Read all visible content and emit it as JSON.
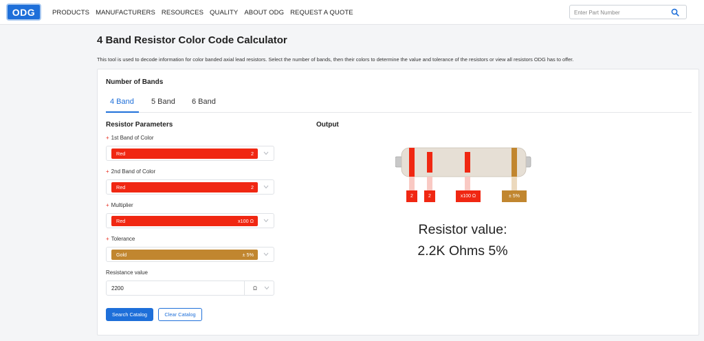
{
  "header": {
    "logo": "ODG",
    "nav": [
      "PRODUCTS",
      "MANUFACTURERS",
      "RESOURCES",
      "QUALITY",
      "ABOUT ODG",
      "REQUEST A QUOTE"
    ],
    "search_placeholder": "Enter Part Number",
    "search_icon": "search-icon"
  },
  "page": {
    "title": "4 Band Resistor Color Code Calculator",
    "description": "This tool is used to decode information for color banded axial lead resistors. Select the number of bands, then their colors to determine the value and tolerance of the resistors or view all resistors ODG has to offer."
  },
  "bands_section": {
    "title": "Number of Bands",
    "tabs": [
      "4 Band",
      "5 Band",
      "6 Band"
    ],
    "active_tab": "4 Band"
  },
  "parameters": {
    "title": "Resistor Parameters",
    "fields": [
      {
        "label": "1st Band of Color",
        "color_name": "Red",
        "value": "2",
        "color": "#f02712"
      },
      {
        "label": "2nd Band of Color",
        "color_name": "Red",
        "value": "2",
        "color": "#f02712"
      },
      {
        "label": "Multiplier",
        "color_name": "Red",
        "value": "x100 Ω",
        "color": "#f02712"
      },
      {
        "label": "Tolerance",
        "color_name": "Gold",
        "value": "± 5%",
        "color": "#c1862f"
      }
    ],
    "resistance_label": "Resistance value",
    "resistance_value": "2200",
    "resistance_unit": "Ω"
  },
  "buttons": {
    "search": "Search Catalog",
    "clear": "Clear Catalog"
  },
  "output": {
    "title": "Output",
    "band_tags": [
      "2",
      "2",
      "x100 Ω",
      "± 5%"
    ],
    "result_line1": "Resistor value:",
    "result_line2": "2.2K Ohms 5%"
  },
  "colors": {
    "accent": "#1e6fd9",
    "red": "#f02712",
    "gold": "#c1862f",
    "body": "#e8e0d6"
  }
}
